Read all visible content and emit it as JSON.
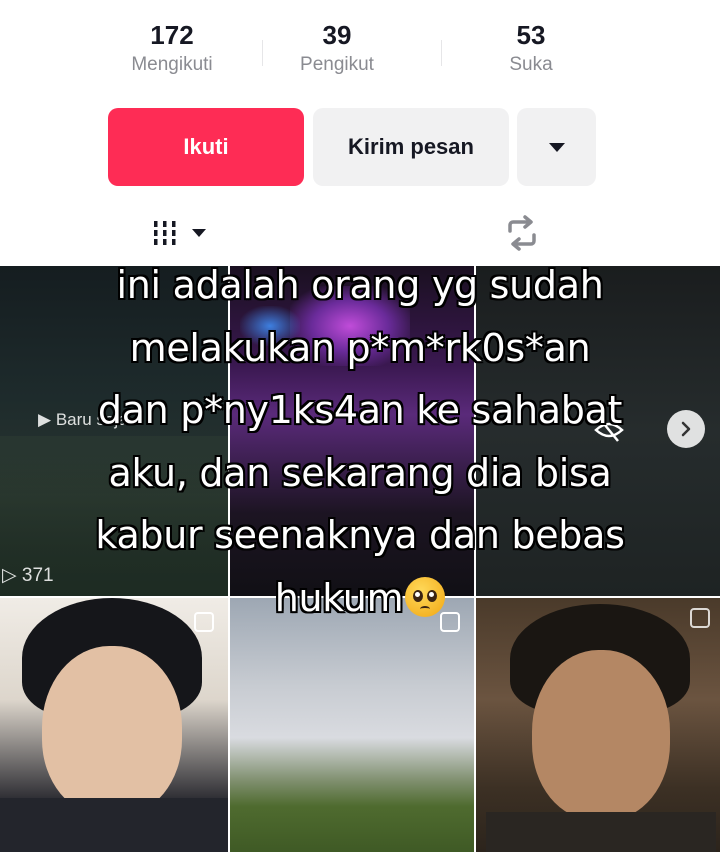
{
  "stats": [
    {
      "value": "172",
      "label": "Mengikuti"
    },
    {
      "value": "39",
      "label": "Pengikut"
    },
    {
      "value": "53",
      "label": "Suka"
    }
  ],
  "actions": {
    "follow_label": "Ikuti",
    "message_label": "Kirim pesan",
    "more_icon": "caret-down-icon"
  },
  "tabs": [
    {
      "icon": "grid-menu-icon",
      "selected": true
    },
    {
      "icon": "repost-icon",
      "selected": false
    }
  ],
  "videos": [
    {
      "badge_text": "Baru saja",
      "views": "371"
    },
    {
      "badge_text": ""
    },
    {
      "badge_text": ""
    },
    {
      "badge_text": ""
    },
    {
      "badge_text": ""
    },
    {
      "badge_text": ""
    }
  ],
  "overlay": {
    "caption_lines": [
      "ini adalah orang yg sudah",
      "melakukan p*m*rk0s*an",
      "dan p*ny1ks4an ke sahabat",
      "aku, dan sekarang dia bisa",
      "kabur seenaknya dan bebas",
      "hukum"
    ],
    "emoji": "pleading-face-emoji"
  },
  "colors": {
    "accent": "#fe2c55",
    "button_bg": "#f1f1f2",
    "text_primary": "#161823",
    "text_secondary": "#8a8b91"
  }
}
